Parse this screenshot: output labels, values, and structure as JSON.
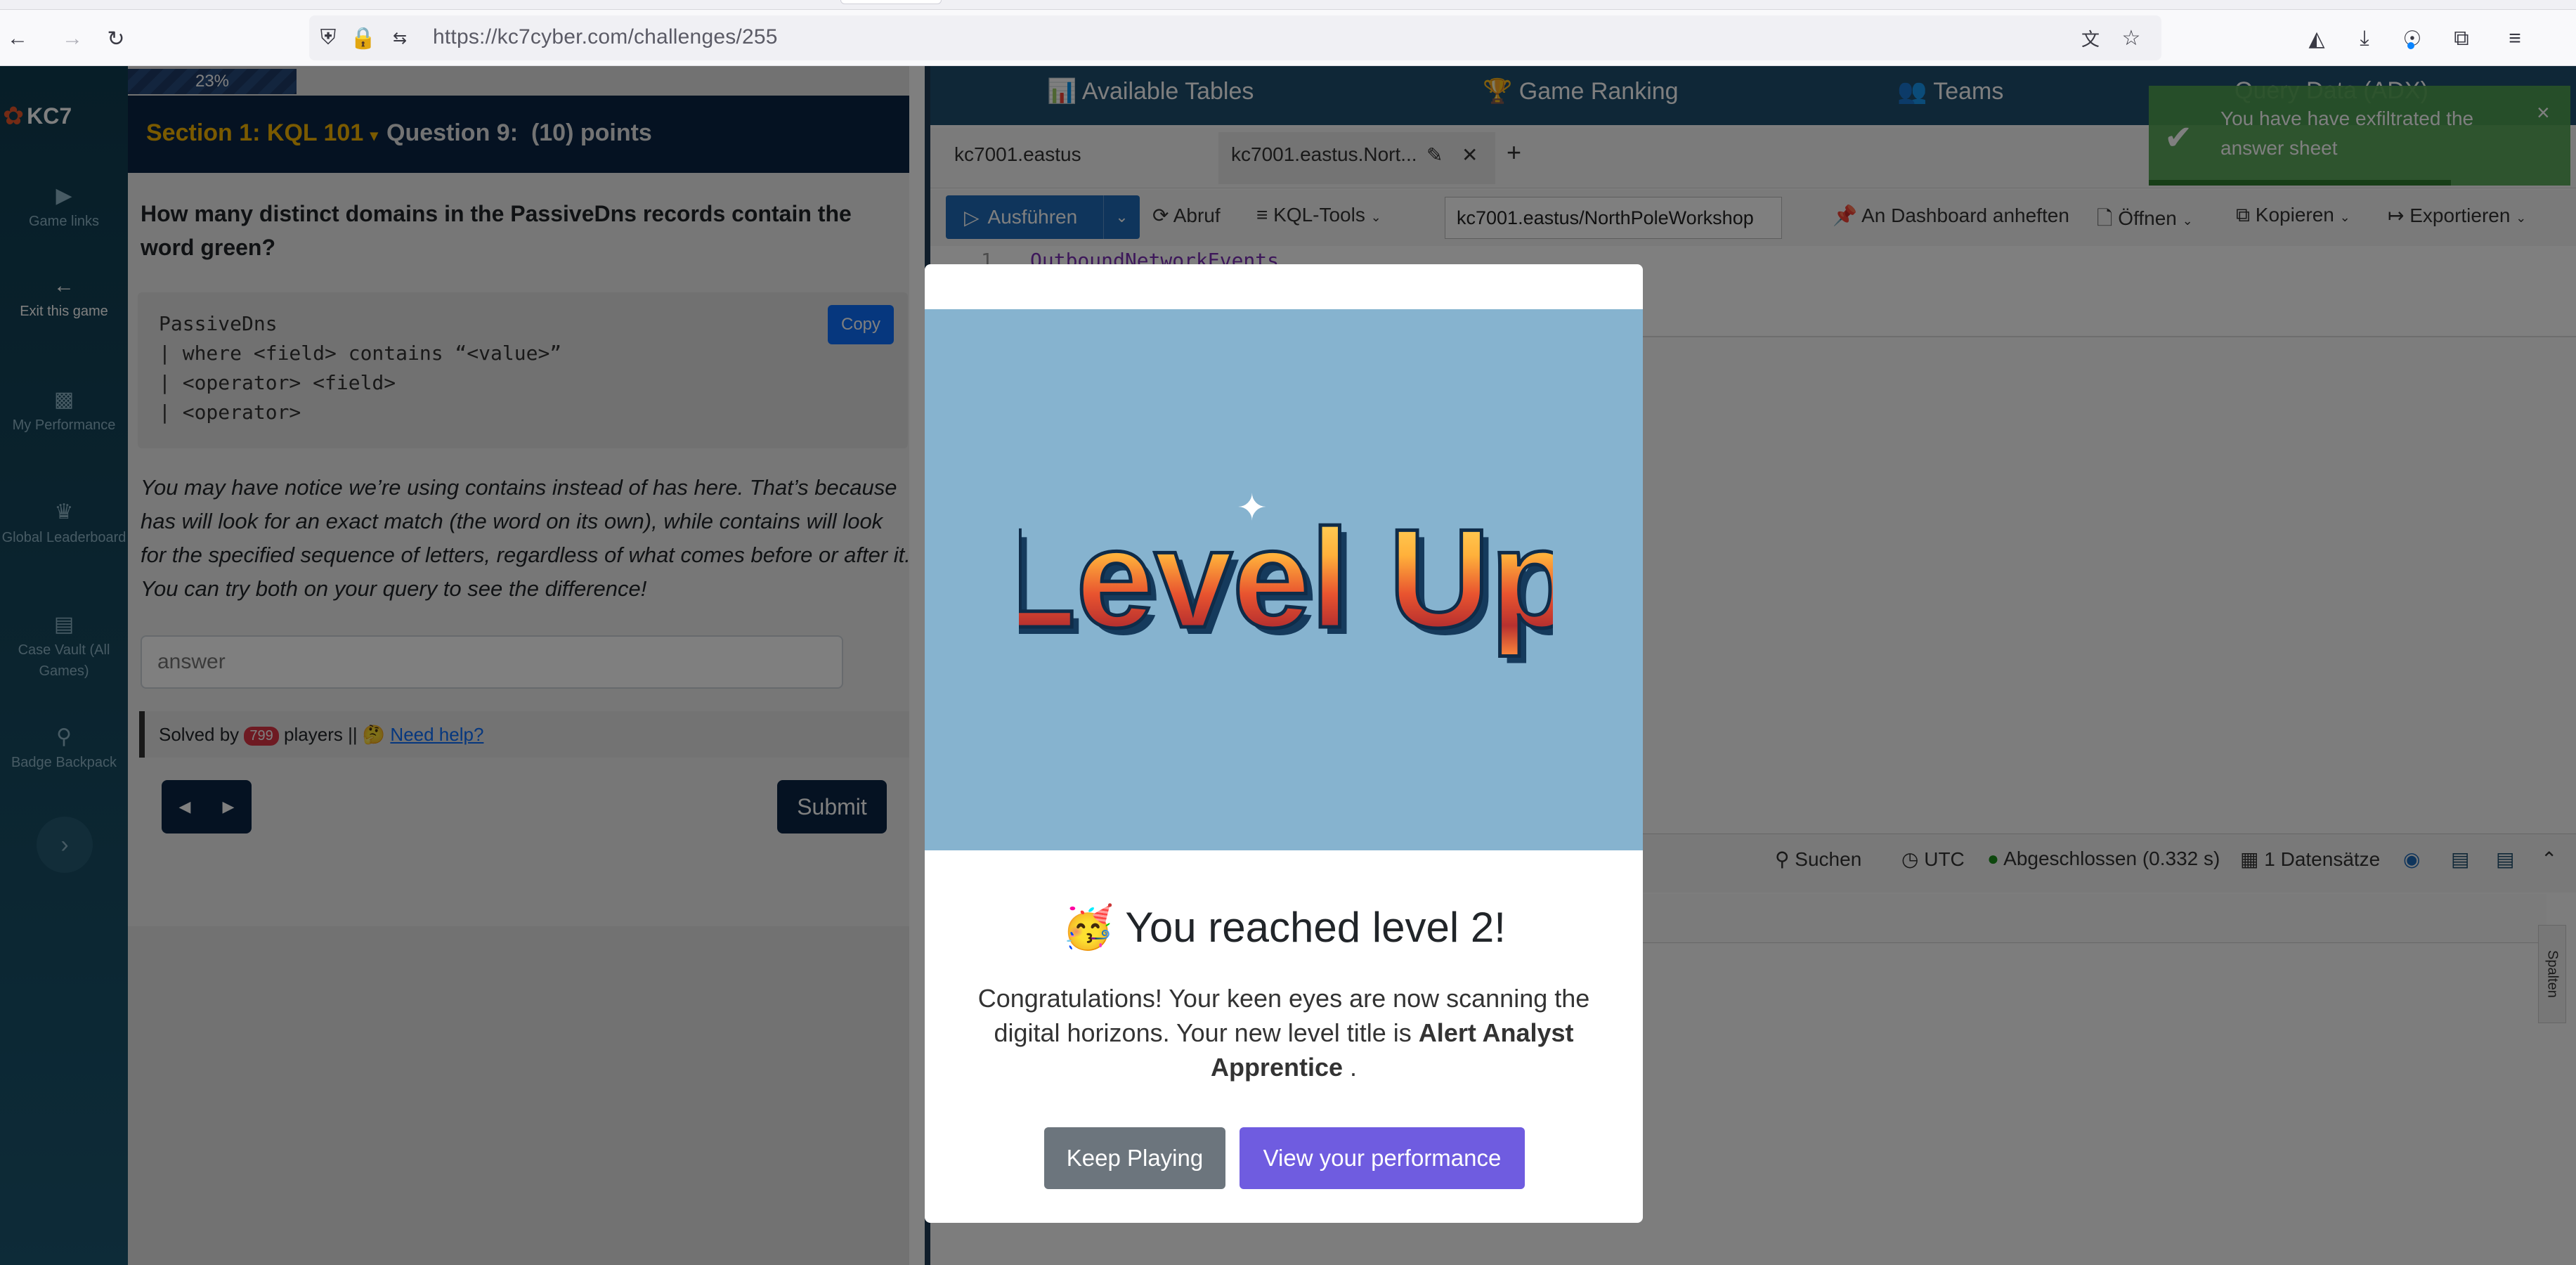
{
  "browser": {
    "url": "https://kc7cyber.com/challenges/255"
  },
  "sidebar": {
    "logo": "KC7",
    "items": [
      {
        "label": "Game links"
      },
      {
        "label": "Exit this game"
      },
      {
        "label": "My Performance"
      },
      {
        "label": "Global Leaderboard"
      },
      {
        "label": "Case Vault (All Games)"
      },
      {
        "label": "Badge Backpack"
      }
    ]
  },
  "challenge": {
    "progress": "23%",
    "progress_fraction": 0.23,
    "section": "Section 1: KQL 101",
    "question_label": "Question 9:",
    "points": "(10) points",
    "question": "How many distinct domains in the PassiveDns records contain the word green?",
    "code_lines": [
      "PassiveDns",
      "| where <field> contains “<value>”",
      "| <operator> <field>",
      "| <operator>"
    ],
    "copy_label": "Copy",
    "explanation": "You may have notice we’re using contains instead of has here. That’s because has will look for an exact match (the word on its own), while contains will look for the specified sequence of letters, regardless of what comes before or after it. You can try both on your query to see the difference!",
    "answer_placeholder": "answer",
    "solved_prefix": "Solved by",
    "solved_count": "799",
    "solved_suffix": "players ||",
    "help_link": "Need help?",
    "submit_label": "Submit"
  },
  "adx": {
    "nav": [
      "Available Tables",
      "Game Ranking",
      "Teams",
      "Query Data (ADX)"
    ],
    "tabs": [
      "kc7001.eastus",
      "kc7001.eastus.Nort..."
    ],
    "run_label": "Ausführen",
    "recall_label": "Abruf",
    "kql_tools_label": "KQL-Tools",
    "database": "kc7001.eastus/NorthPoleWorkshop",
    "pin_label": "An Dashboard anheften",
    "open_label": "Öffnen",
    "copy_label": "Kopieren",
    "export_label": "Exportieren",
    "line_number": "1",
    "query": "OutboundNetworkEvents",
    "search_label": "Suchen",
    "timezone": "UTC",
    "status": "Abgeschlossen (0.332 s)",
    "records": "1 Datensätze",
    "columns_label": "Spalten"
  },
  "toast": {
    "message": "You have have exfiltrated the answer sheet"
  },
  "modal": {
    "art_text": "Level Up",
    "title": "You reached level 2!",
    "body_prefix": "Congratulations! Your keen eyes are now scanning the digital horizons. Your new level title is",
    "level_title": "Alert Analyst Apprentice",
    "body_suffix": ".",
    "keep_label": "Keep Playing",
    "view_label": "View your performance"
  },
  "colors": {
    "navy": "#0b2545",
    "gold": "#f5b400",
    "modal_sky": "#86b3cf",
    "purple": "#6f5ce0",
    "toast_green": "#51a351"
  }
}
